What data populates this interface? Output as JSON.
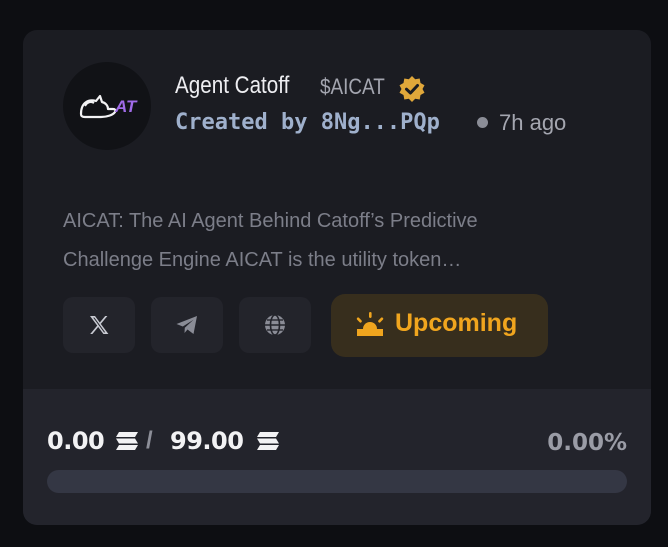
{
  "token": {
    "name": "Agent Catoff",
    "ticker": "$AICAT",
    "logo_text": "AT",
    "creator_prefix": "Created by",
    "creator_address": "8Ng...PQp",
    "created_ago": "7h ago",
    "description_line1": "AICAT: The AI Agent Behind Catoff’s Predictive",
    "description_line2": "Challenge Engine AICAT is the utility token…"
  },
  "links": {
    "x_icon": "x-icon",
    "telegram_icon": "telegram-icon",
    "website_icon": "globe-icon"
  },
  "status": {
    "label": "Upcoming",
    "color": "#f0a51e"
  },
  "funding": {
    "raised": "0.00",
    "separator": "/",
    "target": "99.00",
    "percent_label": "0.00%",
    "progress_fraction": 0.0
  },
  "colors": {
    "accent": "#f0a51e",
    "logo_accent": "#a06be8"
  }
}
